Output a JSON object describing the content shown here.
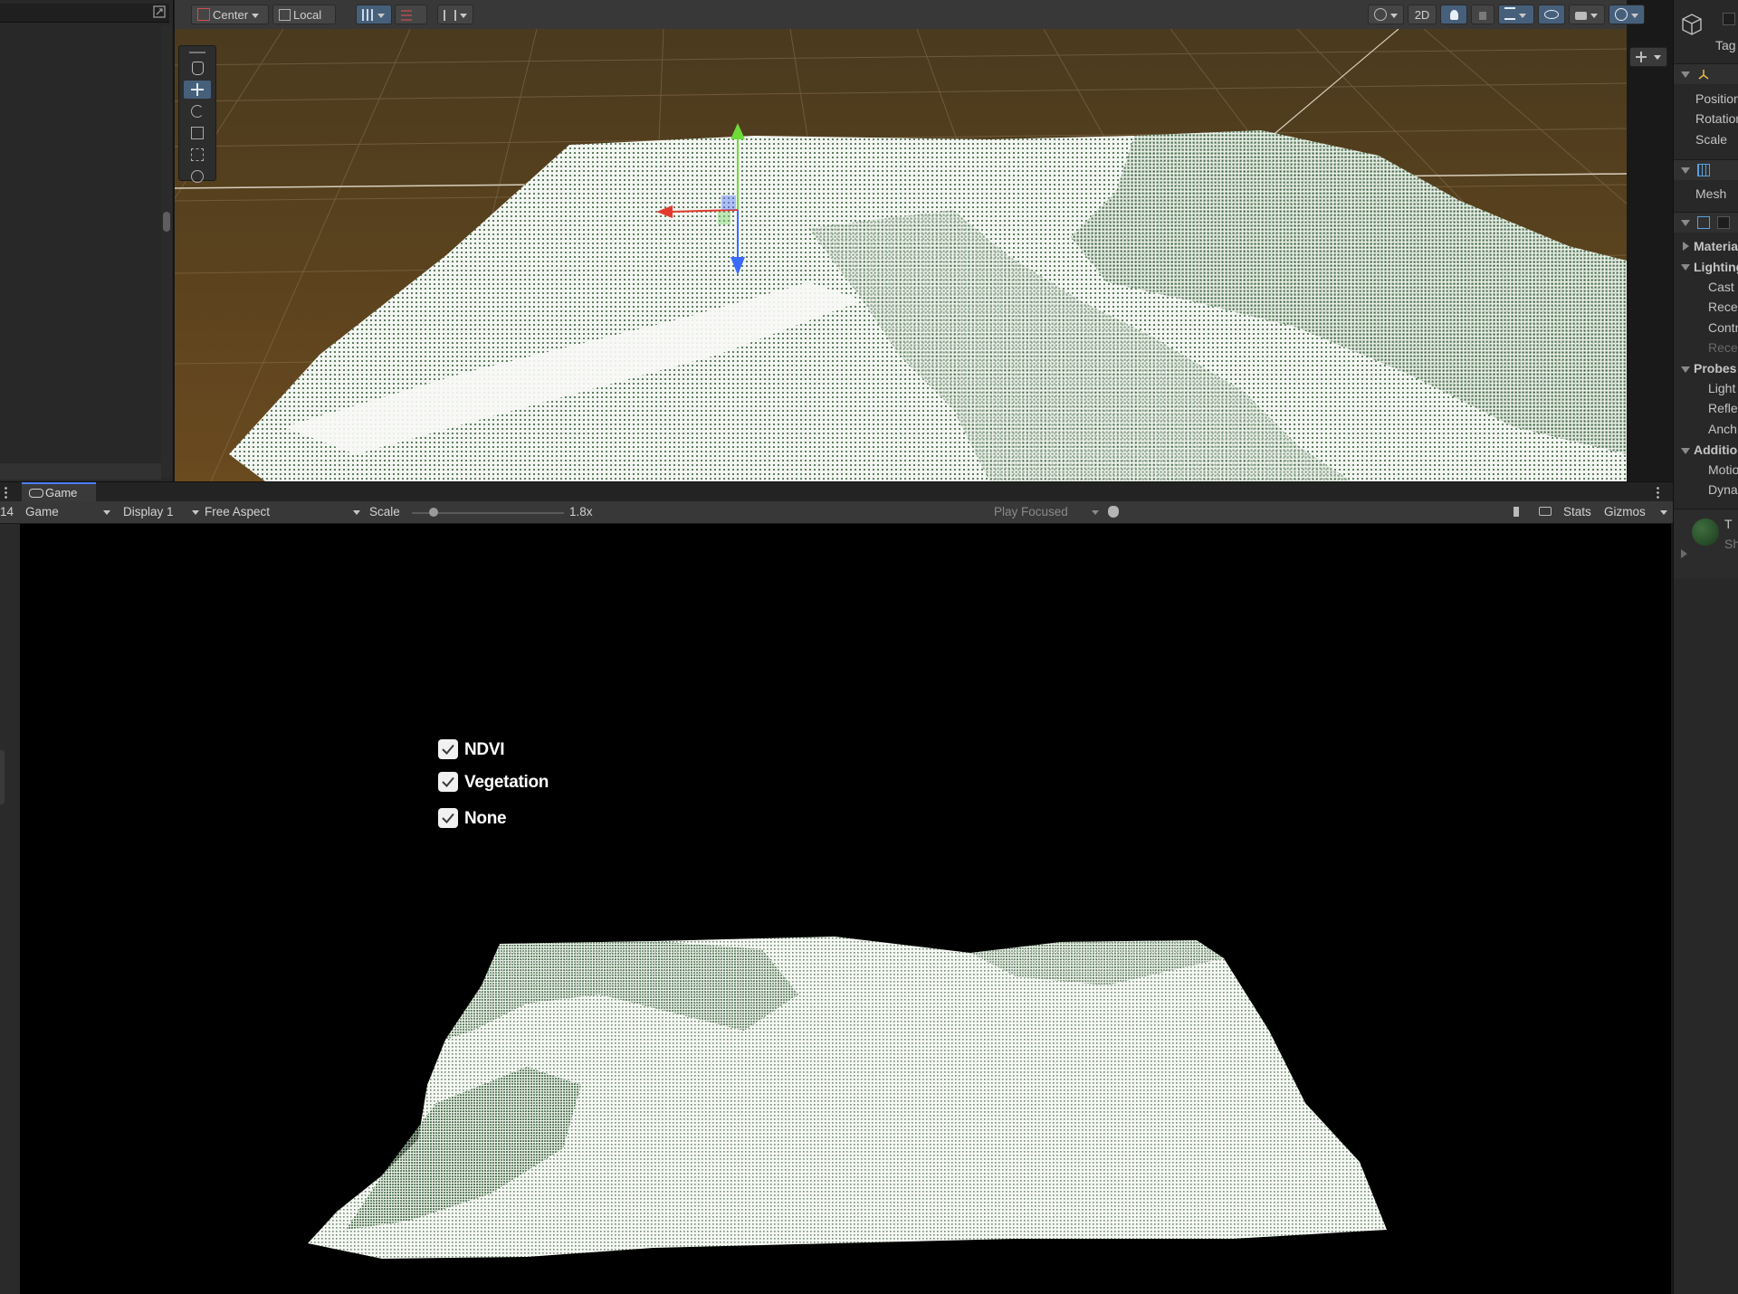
{
  "scene_toolbar": {
    "pivot_label": "Center",
    "space_label": "Local",
    "mode_2d_label": "2D"
  },
  "game_view": {
    "tab_label": "Game",
    "left_number": "14",
    "game_select": "Game",
    "display_select": "Display 1",
    "aspect_select": "Free Aspect",
    "scale_label": "Scale",
    "scale_value": "1.8x",
    "scale_fraction": 0.12,
    "play_focused": "Play Focused",
    "stats_label": "Stats",
    "gizmos_label": "Gizmos"
  },
  "toggles": [
    {
      "label": "NDVI",
      "checked": true
    },
    {
      "label": "Vegetation",
      "checked": true
    },
    {
      "label": "None",
      "checked": true
    }
  ],
  "inspector": {
    "tag_label": "Tag",
    "position": "Position",
    "rotation": "Rotation",
    "scale": "Scale",
    "mesh": "Mesh",
    "materials": "Materia",
    "lighting": "Lighting",
    "cast": "Cast",
    "receive": "Rece",
    "contribute": "Contr",
    "receive2": "Rece",
    "probes": "Probes",
    "light": "Light",
    "reflection": "Refle",
    "anchor": "Anch",
    "additional": "Additio",
    "motion": "Motio",
    "dynamic": "Dyna",
    "t_label": "T",
    "sh_label": "Sh"
  },
  "colors": {
    "terrain_green": "#2f5a32",
    "terrain_white": "#f5f7f4",
    "ground_brown": "#5a3f1c",
    "accent_blue": "#46607c"
  }
}
